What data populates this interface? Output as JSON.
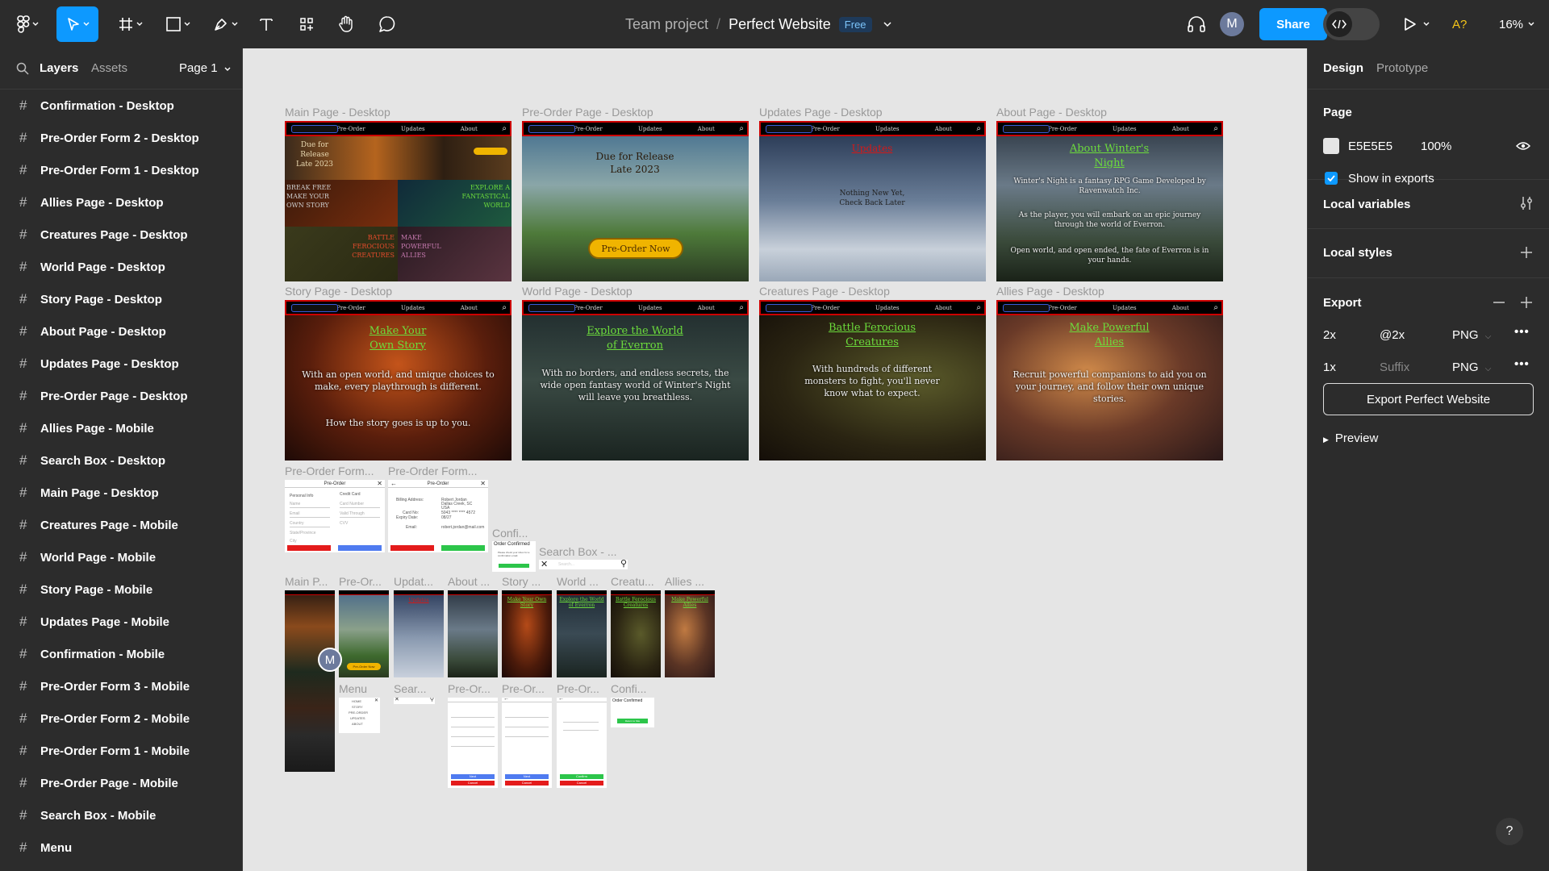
{
  "toolbar": {
    "team": "Team project",
    "file": "Perfect Website",
    "plan_badge": "Free",
    "user_initial": "M",
    "share_label": "Share",
    "mode_badge": "A?",
    "zoom": "16%"
  },
  "left_panel": {
    "tabs": [
      "Layers",
      "Assets"
    ],
    "page_selector": "Page 1",
    "layers": [
      "Confirmation - Desktop",
      "Pre-Order Form 2 - Desktop",
      "Pre-Order Form 1 - Desktop",
      "Allies Page - Desktop",
      "Creatures Page - Desktop",
      "World Page - Desktop",
      "Story Page - Desktop",
      "About Page - Desktop",
      "Updates Page - Desktop",
      "Pre-Order Page - Desktop",
      "Allies Page - Mobile",
      "Search Box - Desktop",
      "Main Page - Desktop",
      "Creatures Page - Mobile",
      "World Page - Mobile",
      "Story Page - Mobile",
      "Updates Page - Mobile",
      "Confirmation - Mobile",
      "Pre-Order Form 3 - Mobile",
      "Pre-Order Form 2 - Mobile",
      "Pre-Order Form 1 - Mobile",
      "Pre-Order Page - Mobile",
      "Search Box - Mobile",
      "Menu"
    ]
  },
  "right_panel": {
    "tabs": [
      "Design",
      "Prototype"
    ],
    "page_section": {
      "title": "Page",
      "color_hex": "E5E5E5",
      "opacity": "100%",
      "show_in_exports_label": "Show in exports",
      "show_in_exports": true
    },
    "local_variables": "Local variables",
    "local_styles": "Local styles",
    "export": {
      "title": "Export",
      "rows": [
        {
          "scale": "2x",
          "suffix": "@2x",
          "suffix_is_placeholder": false,
          "format": "PNG"
        },
        {
          "scale": "1x",
          "suffix": "Suffix",
          "suffix_is_placeholder": true,
          "format": "PNG"
        }
      ],
      "button_label": "Export Perfect Website",
      "preview_label": "Preview"
    },
    "help": "?"
  },
  "canvas": {
    "nav_items": [
      "Pre-Order",
      "Updates",
      "About"
    ],
    "desktop_frames": [
      {
        "label": "Main Page - Desktop",
        "texts": [
          "Due for Release",
          "Late 2023",
          "BREAK FREE",
          "MAKE YOUR",
          "OWN STORY",
          "EXPLORE A",
          "FANTASTICAL",
          "WORLD",
          "BATTLE",
          "FEROCIOUS",
          "CREATURES",
          "MAKE",
          "POWERFUL",
          "ALLIES"
        ]
      },
      {
        "label": "Pre-Order Page - Desktop",
        "texts": [
          "Due for Release",
          "Late 2023",
          "Pre-Order Now"
        ]
      },
      {
        "label": "Updates Page - Desktop",
        "texts": [
          "Updates",
          "Nothing New Yet,",
          "Check Back Later"
        ]
      },
      {
        "label": "About Page - Desktop",
        "texts": [
          "About Winter's",
          "Night",
          "Winter's Night is a fantasy RPG Game Developed by Ravenwatch Inc.",
          "As the player, you will embark on an epic journey through the world of Everron.",
          "Open world, and open ended, the fate of Everron is in your hands."
        ]
      },
      {
        "label": "Story Page - Desktop",
        "texts": [
          "Make Your",
          "Own Story",
          "With an open world, and unique choices to make, every playthrough is different.",
          "How the story goes is up to you."
        ]
      },
      {
        "label": "World Page - Desktop",
        "texts": [
          "Explore the World",
          "of Everron",
          "With no borders, and endless secrets, the wide open fantasy world of Winter's Night will leave you  breathless."
        ]
      },
      {
        "label": "Creatures Page - Desktop",
        "texts": [
          "Battle Ferocious",
          "Creatures",
          "With hundreds of different monsters to fight, you'll never know what to expect."
        ]
      },
      {
        "label": "Allies Page - Desktop",
        "texts": [
          "Make Powerful",
          "Allies",
          "Recruit powerful companions to aid you on your journey, and follow their own unique stories."
        ]
      }
    ],
    "form_frames": [
      {
        "label": "Pre-Order Form...",
        "title": "Pre-Order",
        "section_a": "Personal Info",
        "section_b": "Credit Card",
        "fields_a": [
          "Name",
          "Email",
          "Country",
          "State/Province",
          "City"
        ],
        "fields_b": [
          "Card Number",
          "Valid Through",
          "CVV"
        ],
        "cancel": "Cancel",
        "next": "Next"
      },
      {
        "label": "Pre-Order Form...",
        "title": "Pre-Order",
        "lines": [
          "Billing Address:",
          "Card No:",
          "Expiry Date:",
          "Email:"
        ],
        "values": [
          "Robert Jordan",
          "Dallas Creek, SC",
          "USA",
          "5043 **** **** 4572",
          "08/27",
          "robert.jordan@mail.com"
        ],
        "cancel": "Cancel",
        "confirm": "Confirm"
      },
      {
        "label": "Confi...",
        "title": "Order Confirmed",
        "body": "Please check your inbox for a confirmation email.",
        "button": "Return to Site"
      },
      {
        "label": "Search Box - ...",
        "placeholder": "Search..."
      }
    ],
    "mobile_labels": [
      "Main P...",
      "Pre-Or...",
      "Updat...",
      "About ...",
      "Story ...",
      "World ...",
      "Creatu...",
      "Allies ..."
    ],
    "mobile_titles": [
      "Updates",
      "Make Your Own Story",
      "Explore the World of Everron",
      "Battle Ferocious Creatures",
      "Make Powerful Allies"
    ],
    "mobile_main_badge": "Pre-Order Now",
    "mobile_second_labels": [
      "Menu",
      "Sear...",
      "Pre-Or...",
      "Pre-Or...",
      "Pre-Or...",
      "Confi..."
    ],
    "menu_items": [
      "HOME",
      "STORY",
      "PRE-ORDER",
      "UPDATES",
      "ABOUT"
    ],
    "mobile_form_buttons": [
      "Next",
      "Cancel",
      "Next",
      "Cancel",
      "Confirm",
      "Cancel"
    ],
    "mobile_confirm": {
      "title": "Order Confirmed",
      "button": "Return to Site"
    },
    "canvas_avatar": "M"
  }
}
